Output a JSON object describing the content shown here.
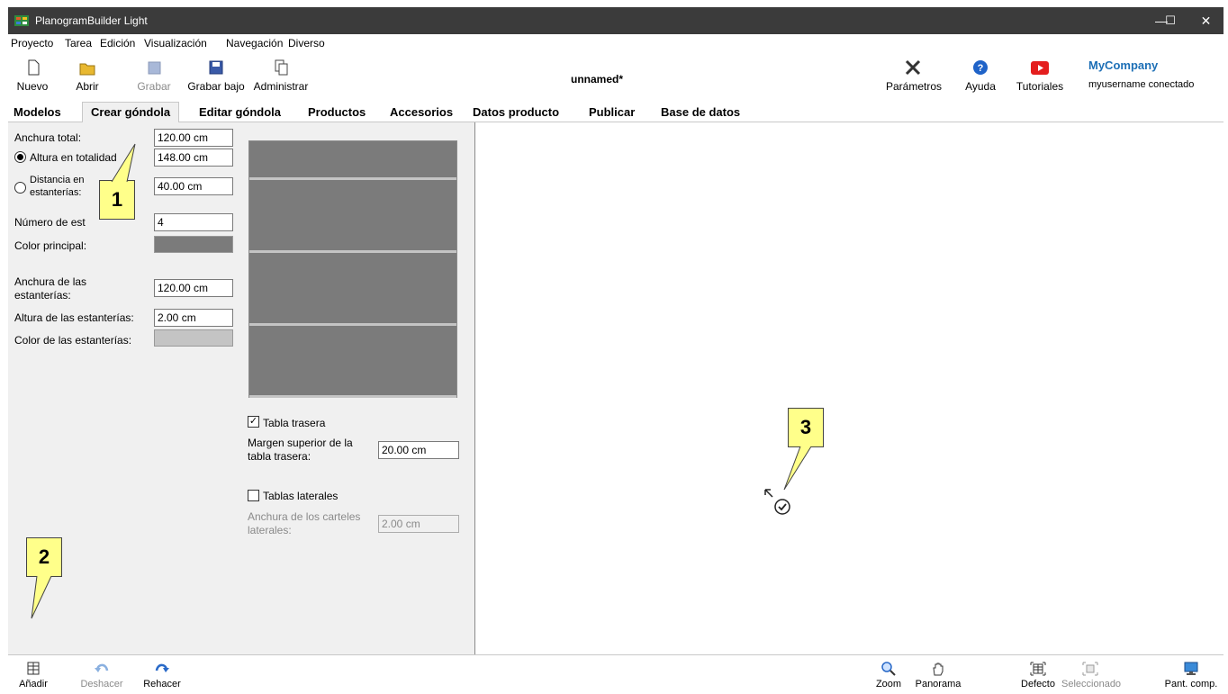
{
  "window": {
    "title": "PlanogramBuilder Light",
    "minimize": "—",
    "maximize": "☐",
    "close": "✕"
  },
  "menu": [
    "Proyecto",
    "Tarea",
    "Edición",
    "Visualización",
    "Navegación",
    "Diverso"
  ],
  "toolbar": {
    "nuevo": "Nuevo",
    "abrir": "Abrir",
    "grabar": "Grabar",
    "grabar_bajo": "Grabar bajo",
    "administrar": "Administrar",
    "document_title": "unnamed*",
    "parametros": "Parámetros",
    "ayuda": "Ayuda",
    "tutoriales": "Tutoriales",
    "company": "MyCompany",
    "user_status": "myusername conectado"
  },
  "tabs": [
    "Modelos",
    "Crear góndola",
    "Editar góndola",
    "Productos",
    "Accesorios",
    "Datos producto",
    "Publicar",
    "Base de datos"
  ],
  "active_tab": "Crear góndola",
  "form": {
    "anchura_total_label": "Anchura total:",
    "anchura_total_value": "120.00 cm",
    "altura_label": "Altura en totalidad",
    "altura_value": "148.00 cm",
    "distancia_label_1": "Distancia en",
    "distancia_label_2": "estanterías:",
    "distancia_value": "40.00 cm",
    "numero_label": "Número de est",
    "numero_value": "4",
    "color_principal_label": "Color principal:",
    "color_principal": "#7b7b7b",
    "anchura_estanterias_label_1": "Anchura de las",
    "anchura_estanterias_label_2": "estanterías:",
    "anchura_estanterias_value": "120.00 cm",
    "altura_estanterias_label": "Altura de las estanterías:",
    "altura_estanterias_value": "2.00 cm",
    "color_estanterias_label": "Color de las estanterías:",
    "color_estanterias": "#c4c4c4",
    "tabla_trasera_label": "Tabla trasera",
    "tabla_trasera_checked": true,
    "margen_label_1": "Margen superior de la",
    "margen_label_2": "tabla trasera:",
    "margen_value": "20.00 cm",
    "tablas_laterales_label": "Tablas laterales",
    "tablas_laterales_checked": false,
    "anchura_carteles_label_1": "Anchura de los carteles",
    "anchura_carteles_label_2": "laterales:",
    "anchura_carteles_value": "2.00 cm"
  },
  "callouts": [
    "1",
    "2",
    "3"
  ],
  "bottombar": {
    "anadir": "Añadir",
    "deshacer": "Deshacer",
    "rehacer": "Rehacer",
    "zoom": "Zoom",
    "panorama": "Panorama",
    "defecto": "Defecto",
    "seleccionado": "Seleccionado",
    "pant_comp": "Pant. comp."
  }
}
